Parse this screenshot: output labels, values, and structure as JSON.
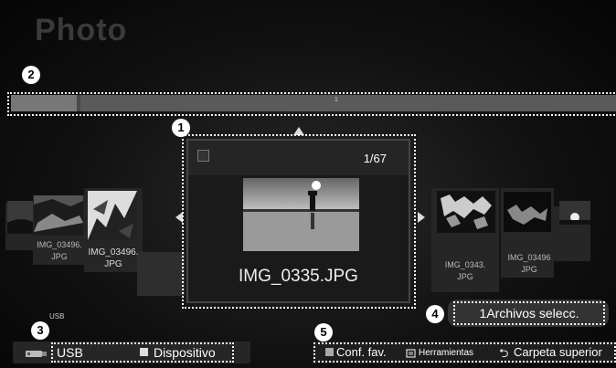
{
  "header": {
    "title": "Photo"
  },
  "callouts": [
    "1",
    "2",
    "3",
    "4",
    "5"
  ],
  "center": {
    "counter": "1/67",
    "filename": "IMG_0335.JPG"
  },
  "left_thumbs": [
    {
      "label": "IMG_03496.\nJPG"
    },
    {
      "label": "IMG_03496.\nJPG"
    }
  ],
  "right_thumbs": [
    {
      "label": "IMG_0343.\nJPG"
    },
    {
      "label": "IMG_03496\nJPG"
    }
  ],
  "folderbar": {
    "tick": "1"
  },
  "device": {
    "small_label": "USB",
    "usb_label": "USB",
    "device_label": "Dispositivo"
  },
  "selection": {
    "status": "1Archivos selecc."
  },
  "footer": {
    "fav_label": "Conf. fav.",
    "tools_label": "Herramientas",
    "parent_label": "Carpeta superior"
  },
  "colors": {
    "fav_square": "#a9a9a9",
    "dotted_border": "#ffffff"
  },
  "icons": [
    "usb-device-icon",
    "up-arrow-icon",
    "left-arrow-icon",
    "right-arrow-icon",
    "tools-icon",
    "return-icon",
    "checkbox-icon"
  ]
}
